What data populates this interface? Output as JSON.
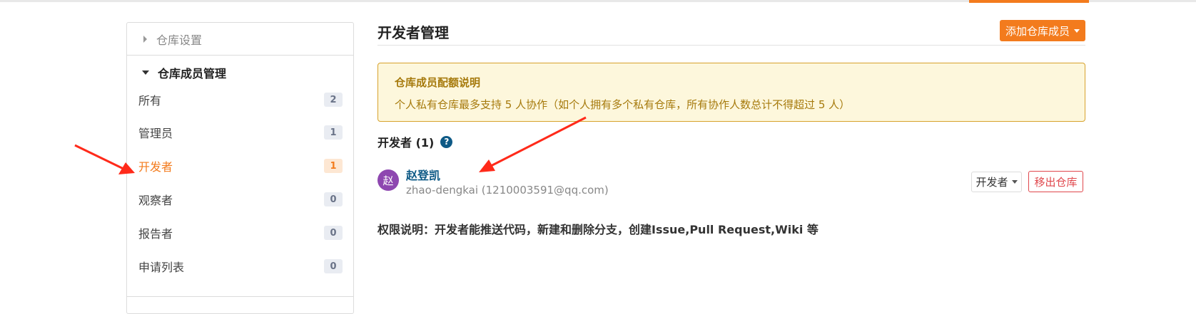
{
  "sidebar": {
    "section_collapsed": "仓库设置",
    "section_expanded": "仓库成员管理",
    "items": [
      {
        "label": "所有",
        "count": "2",
        "active": false
      },
      {
        "label": "管理员",
        "count": "1",
        "active": false
      },
      {
        "label": "开发者",
        "count": "1",
        "active": true
      },
      {
        "label": "观察者",
        "count": "0",
        "active": false
      },
      {
        "label": "报告者",
        "count": "0",
        "active": false
      },
      {
        "label": "申请列表",
        "count": "0",
        "active": false
      }
    ]
  },
  "main": {
    "title": "开发者管理",
    "add_button": "添加仓库成员",
    "notice": {
      "title": "仓库成员配额说明",
      "body": "个人私有仓库最多支持 5 人协作（如个人拥有多个私有仓库，所有协作人数总计不得超过 5 人）"
    },
    "developers_heading": "开发者 (1)",
    "help_icon": "?",
    "member": {
      "avatar_char": "赵",
      "name": "赵登凯",
      "email": "zhao-dengkai (1210003591@qq.com)",
      "role": "开发者",
      "remove_label": "移出仓库"
    },
    "permission_note": "权限说明：开发者能推送代码，新建和删除分支，创建Issue,Pull Request,Wiki 等"
  },
  "colors": {
    "accent": "#f37b1d",
    "link": "#0e5a86",
    "danger": "#e0474c",
    "notice_bg": "#fdf7dc",
    "notice_text": "#a67a0c",
    "avatar_bg": "#8e47b0"
  }
}
